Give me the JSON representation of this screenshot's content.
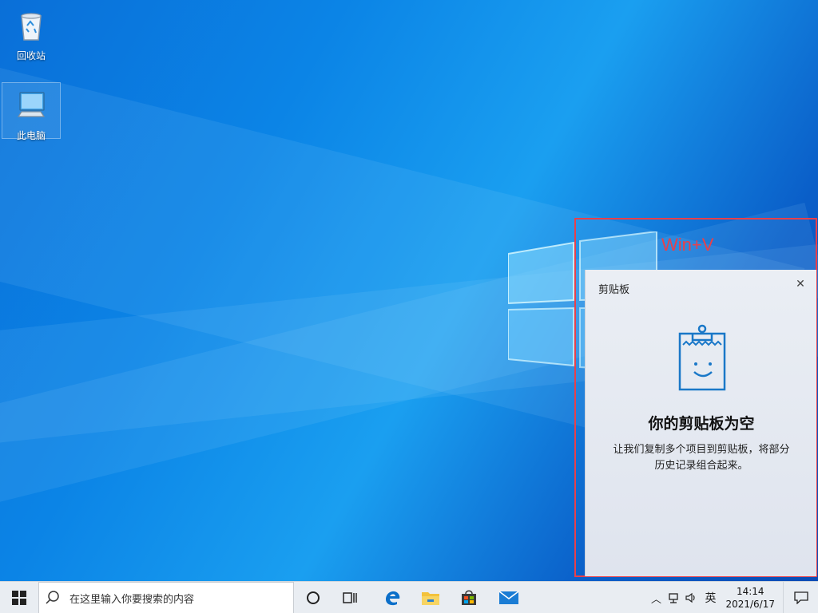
{
  "desktop": {
    "icons": [
      {
        "label": "回收站",
        "icon": "recycle-bin-icon"
      },
      {
        "label": "此电脑",
        "icon": "computer-icon"
      }
    ]
  },
  "annotation": {
    "hotkey": "Win+V",
    "color": "#e8404a"
  },
  "clipboard": {
    "title": "剪贴板",
    "close_icon": "close-icon",
    "heading": "你的剪贴板为空",
    "description_line1": "让我们复制多个项目到剪贴板，将部分",
    "description_line2": "历史记录组合起来。",
    "illustration_icon": "empty-clipboard-icon"
  },
  "taskbar": {
    "start_icon": "windows-start-icon",
    "search_placeholder": "在这里输入你要搜索的内容",
    "pinned": [
      "cortana-icon",
      "task-view-icon",
      "edge-icon",
      "file-explorer-icon",
      "store-icon",
      "mail-icon"
    ],
    "tray": {
      "ime": "英",
      "time": "14:14",
      "date": "2021/6/17"
    }
  },
  "colors": {
    "accent": "#0078d7",
    "highlight": "#e8404a"
  }
}
